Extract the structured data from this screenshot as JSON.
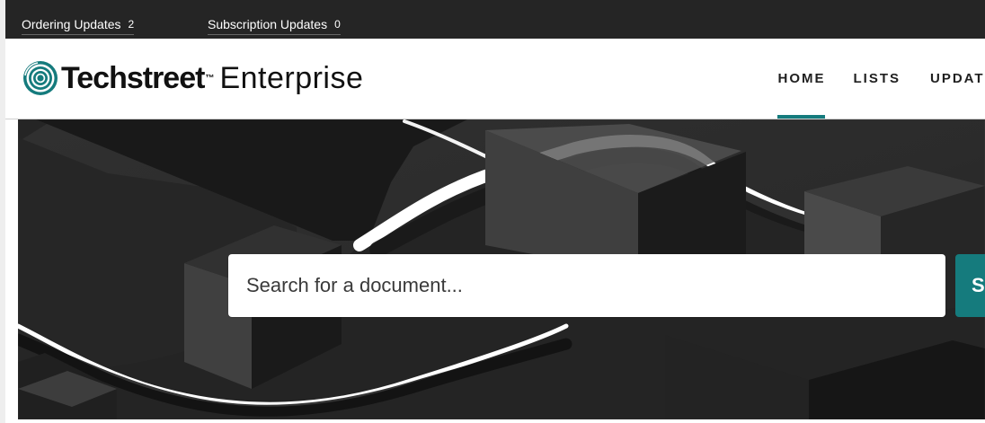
{
  "utility_bar": {
    "ordering_updates": {
      "label": "Ordering Updates",
      "count": "2"
    },
    "subscription_updates": {
      "label": "Subscription Updates",
      "count": "0"
    }
  },
  "brand": {
    "name": "Techstreet",
    "trademark": "™",
    "suffix": "Enterprise",
    "logo_icon": "concentric-circles-icon"
  },
  "nav": {
    "items": [
      {
        "label": "HOME",
        "active": true
      },
      {
        "label": "LISTS",
        "active": false
      },
      {
        "label": "UPDAT",
        "active": false
      }
    ]
  },
  "search": {
    "placeholder": "Search for a document...",
    "button_label": "S"
  },
  "colors": {
    "accent": "#157b7d",
    "utility_bar": "#252525"
  }
}
